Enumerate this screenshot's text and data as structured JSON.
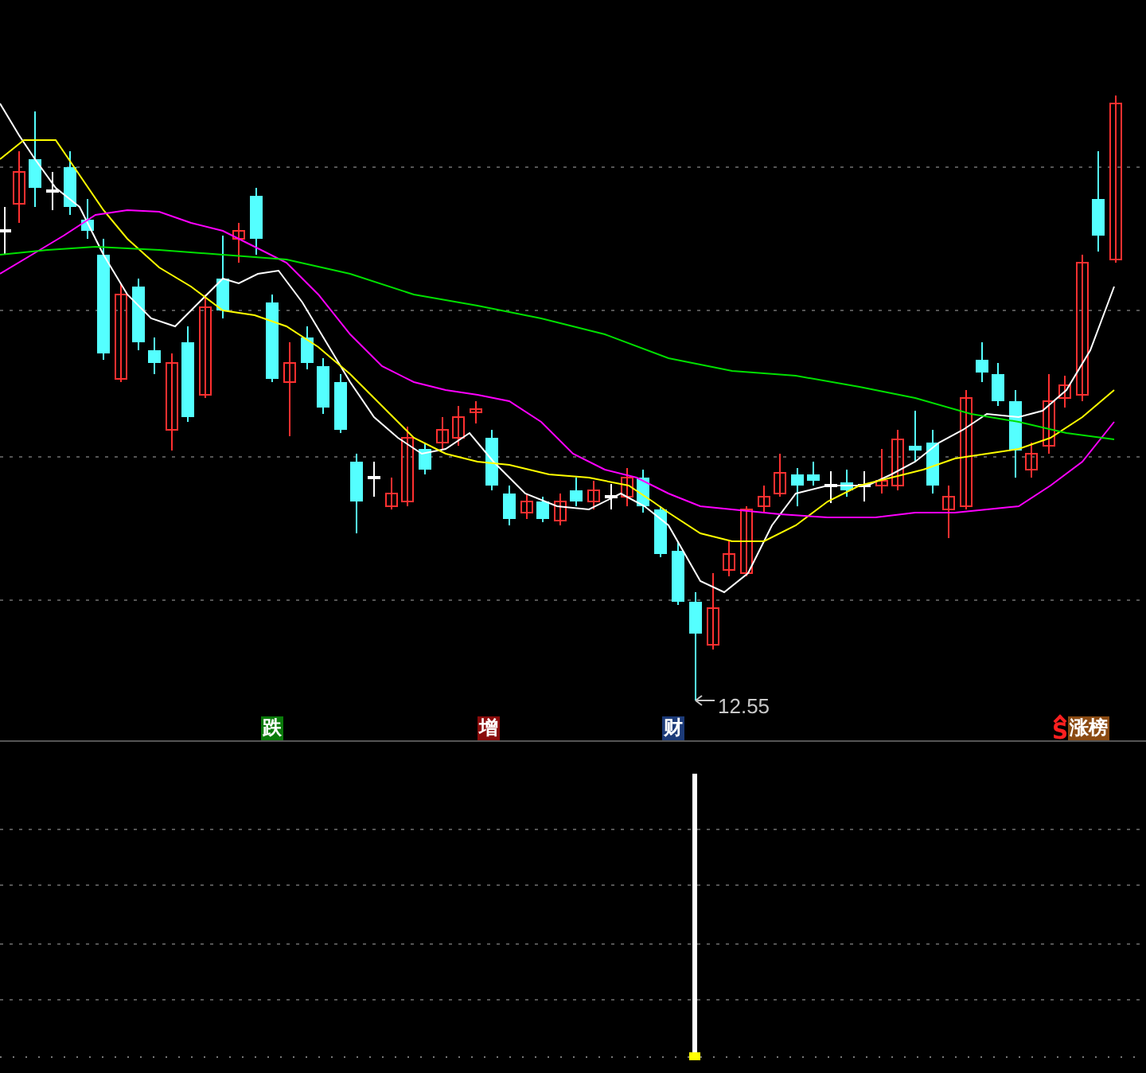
{
  "price_chart": {
    "low_label": "12.55",
    "markers": [
      {
        "text": "跌",
        "kind": "tag",
        "color": "#0a7a0a"
      },
      {
        "text": "增",
        "kind": "tag",
        "color": "#8a0a0a"
      },
      {
        "text": "财",
        "kind": "tag",
        "color": "#1c3a78"
      },
      {
        "text": "S",
        "kind": "glyph",
        "color": "#ff2020"
      },
      {
        "text": "涨榜",
        "kind": "tag",
        "color": "#8a4a12"
      }
    ]
  }
}
